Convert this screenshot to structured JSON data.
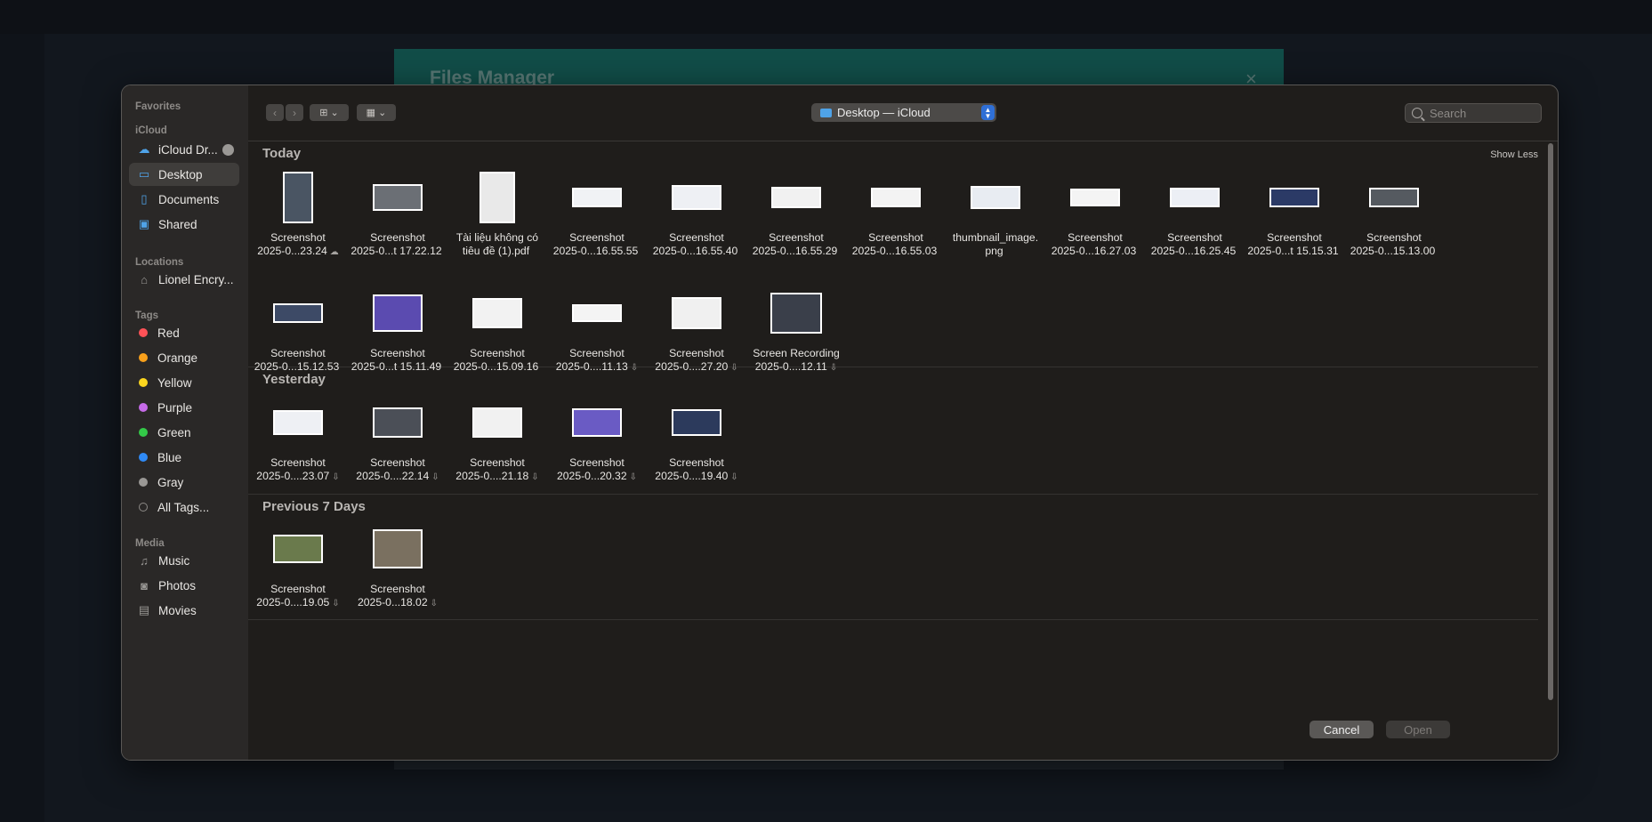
{
  "background": {
    "modal_title": "Files Manager",
    "modal_close": "×"
  },
  "sidebar": {
    "favorites_heading": "Favorites",
    "icloud_heading": "iCloud",
    "icloud_items": [
      {
        "label": "iCloud Dr...",
        "icon": "cloud-icon"
      },
      {
        "label": "Desktop",
        "icon": "desktop-icon",
        "selected": true
      },
      {
        "label": "Documents",
        "icon": "document-icon"
      },
      {
        "label": "Shared",
        "icon": "shared-folder-icon"
      }
    ],
    "locations_heading": "Locations",
    "location_items": [
      {
        "label": "Lionel Encry...",
        "icon": "drive-icon"
      }
    ],
    "tags_heading": "Tags",
    "tags": [
      {
        "label": "Red",
        "color": "#ff5257"
      },
      {
        "label": "Orange",
        "color": "#f8a01b"
      },
      {
        "label": "Yellow",
        "color": "#fcd61e"
      },
      {
        "label": "Purple",
        "color": "#c66be8"
      },
      {
        "label": "Green",
        "color": "#33c948"
      },
      {
        "label": "Blue",
        "color": "#2f8af5"
      },
      {
        "label": "Gray",
        "color": "#9a9895"
      },
      {
        "label": "All Tags...",
        "color": ""
      }
    ],
    "media_heading": "Media",
    "media_items": [
      {
        "label": "Music",
        "icon": "music-note-icon"
      },
      {
        "label": "Photos",
        "icon": "camera-icon"
      },
      {
        "label": "Movies",
        "icon": "film-icon"
      }
    ]
  },
  "toolbar": {
    "back": "‹",
    "forward": "›",
    "location_label": "Desktop — iCloud",
    "search_placeholder": "Search"
  },
  "groups": [
    {
      "title": "Today",
      "show_less": "Show Less",
      "files": [
        {
          "line1": "Screenshot",
          "line2": "2025-0...23.24",
          "cloud": "☁"
        },
        {
          "line1": "Screenshot",
          "line2": "2025-0...t 17.22.12",
          "cloud": ""
        },
        {
          "line1": "Tài liệu không có",
          "line2": "tiêu đề (1).pdf",
          "cloud": ""
        },
        {
          "line1": "Screenshot",
          "line2": "2025-0...16.55.55",
          "cloud": ""
        },
        {
          "line1": "Screenshot",
          "line2": "2025-0...16.55.40",
          "cloud": ""
        },
        {
          "line1": "Screenshot",
          "line2": "2025-0...16.55.29",
          "cloud": ""
        },
        {
          "line1": "Screenshot",
          "line2": "2025-0...16.55.03",
          "cloud": ""
        },
        {
          "line1": "thumbnail_image.",
          "line2": "png",
          "cloud": ""
        },
        {
          "line1": "Screenshot",
          "line2": "2025-0...16.27.03",
          "cloud": ""
        },
        {
          "line1": "Screenshot",
          "line2": "2025-0...16.25.45",
          "cloud": ""
        },
        {
          "line1": "Screenshot",
          "line2": "2025-0...t 15.15.31",
          "cloud": ""
        },
        {
          "line1": "Screenshot",
          "line2": "2025-0...15.13.00",
          "cloud": ""
        },
        {
          "line1": "Screenshot",
          "line2": "2025-0...15.12.53",
          "cloud": ""
        },
        {
          "line1": "Screenshot",
          "line2": "2025-0...t 15.11.49",
          "cloud": ""
        },
        {
          "line1": "Screenshot",
          "line2": "2025-0...15.09.16",
          "cloud": ""
        },
        {
          "line1": "Screenshot",
          "line2": "2025-0....11.13",
          "cloud": "⇩"
        },
        {
          "line1": "Screenshot",
          "line2": "2025-0....27.20",
          "cloud": "⇩"
        },
        {
          "line1": "Screen Recording",
          "line2": "2025-0....12.11",
          "cloud": "⇩"
        }
      ]
    },
    {
      "title": "Yesterday",
      "files": [
        {
          "line1": "Screenshot",
          "line2": "2025-0....23.07",
          "cloud": "⇩"
        },
        {
          "line1": "Screenshot",
          "line2": "2025-0....22.14",
          "cloud": "⇩"
        },
        {
          "line1": "Screenshot",
          "line2": "2025-0....21.18",
          "cloud": "⇩"
        },
        {
          "line1": "Screenshot",
          "line2": "2025-0...20.32",
          "cloud": "⇩"
        },
        {
          "line1": "Screenshot",
          "line2": "2025-0....19.40",
          "cloud": "⇩"
        }
      ]
    },
    {
      "title": "Previous 7 Days",
      "files": [
        {
          "line1": "Screenshot",
          "line2": "2025-0....19.05",
          "cloud": "⇩"
        },
        {
          "line1": "Screenshot",
          "line2": "2025-0...18.02",
          "cloud": "⇩"
        }
      ]
    }
  ],
  "footer": {
    "cancel": "Cancel",
    "open": "Open"
  }
}
